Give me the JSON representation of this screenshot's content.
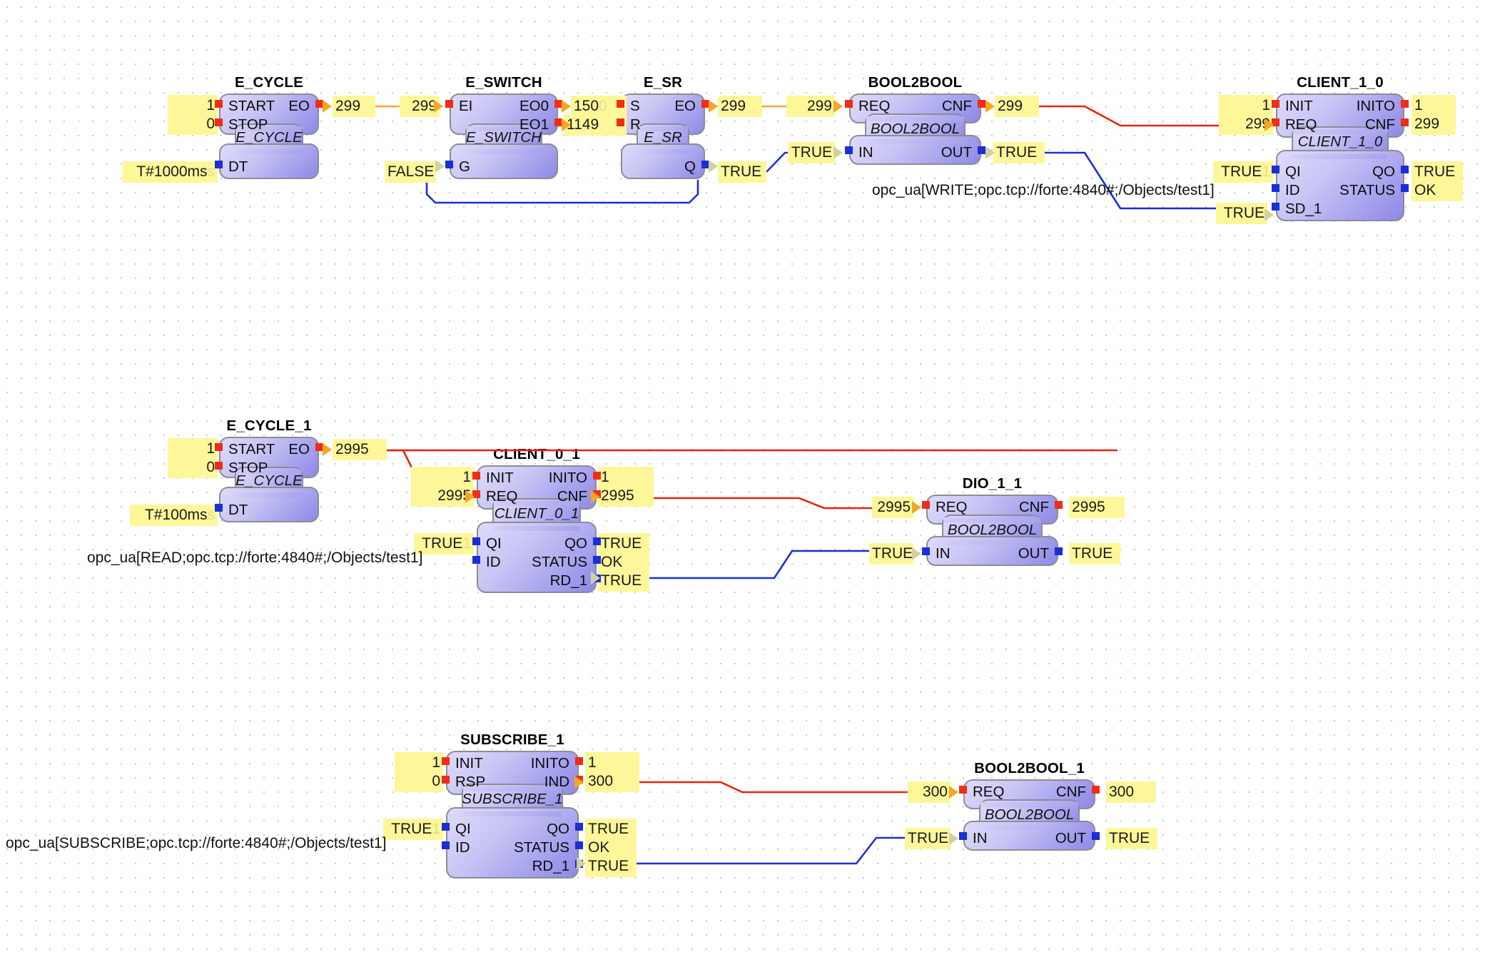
{
  "editor": {
    "kind": "iec61499-fb-network",
    "background": "#ffffff",
    "grid_dot_color": "#c9c9c9",
    "colors": {
      "event_pin": "#ef2d18",
      "data_pin": "#1a2fd6",
      "event_wire": "#e8240f",
      "data_wire": "#1a2fd6",
      "watch_value_bg": "#fdf79a",
      "fb_fill_light": "#dedcfa",
      "fb_fill_dark": "#8e89e6",
      "fb_border": "#8c8c96"
    }
  },
  "blocks": [
    {
      "id": "e_cycle",
      "instance_name": "E_CYCLE",
      "type_name": "E_CYCLE",
      "event_inputs": [
        {
          "name": "START",
          "value": "1"
        },
        {
          "name": "STOP",
          "value": "0"
        }
      ],
      "event_outputs": [
        {
          "name": "EO",
          "value": "299"
        }
      ],
      "data_inputs": [
        {
          "name": "DT",
          "value": "T#1000ms",
          "ghost": "s"
        }
      ],
      "data_outputs": []
    },
    {
      "id": "e_switch",
      "instance_name": "E_SWITCH",
      "type_name": "E_SWITCH",
      "event_inputs": [
        {
          "name": "EI",
          "value": "299"
        }
      ],
      "event_outputs": [
        {
          "name": "EO0",
          "value": "150",
          "ghost": "0"
        },
        {
          "name": "EO1",
          "value": "1149",
          "ghost": "114"
        }
      ],
      "data_inputs": [
        {
          "name": "G",
          "value": "FALSE"
        }
      ],
      "data_outputs": []
    },
    {
      "id": "e_sr",
      "instance_name": "E_SR",
      "type_name": "E_SR",
      "event_inputs": [
        {
          "name": "S",
          "value": ""
        },
        {
          "name": "R",
          "value": ""
        }
      ],
      "event_outputs": [
        {
          "name": "EO",
          "value": "299"
        }
      ],
      "data_inputs": [],
      "data_outputs": [
        {
          "name": "Q",
          "value": "TRUE"
        }
      ]
    },
    {
      "id": "bool2bool",
      "instance_name": "BOOL2BOOL",
      "type_name": "BOOL2BOOL",
      "event_inputs": [
        {
          "name": "REQ",
          "value": "299"
        }
      ],
      "event_outputs": [
        {
          "name": "CNF",
          "value": "299"
        }
      ],
      "data_inputs": [
        {
          "name": "IN",
          "value": "TRUE"
        }
      ],
      "data_outputs": [
        {
          "name": "OUT",
          "value": "TRUE"
        }
      ]
    },
    {
      "id": "client_1_0",
      "instance_name": "CLIENT_1_0",
      "type_name": "CLIENT_1_0",
      "event_inputs": [
        {
          "name": "INIT",
          "value": "1"
        },
        {
          "name": "REQ",
          "value": "299"
        }
      ],
      "event_outputs": [
        {
          "name": "INITO",
          "value": "1"
        },
        {
          "name": "CNF",
          "value": "299"
        }
      ],
      "data_inputs": [
        {
          "name": "QI",
          "value": "TRUE",
          "ghost": "1"
        },
        {
          "name": "ID",
          "value": "opc_ua[WRITE;opc.tcp://forte:4840#;/Objects/test1]"
        },
        {
          "name": "SD_1",
          "value": "TRUE"
        }
      ],
      "data_outputs": [
        {
          "name": "QO",
          "value": "TRUE"
        },
        {
          "name": "STATUS",
          "value": "OK"
        }
      ]
    },
    {
      "id": "e_cycle_1",
      "instance_name": "E_CYCLE_1",
      "type_name": "E_CYCLE",
      "event_inputs": [
        {
          "name": "START",
          "value": "1"
        },
        {
          "name": "STOP",
          "value": "0"
        }
      ],
      "event_outputs": [
        {
          "name": "EO",
          "value": "2995"
        }
      ],
      "data_inputs": [
        {
          "name": "DT",
          "value": "T#100ms",
          "ghost": "s"
        }
      ],
      "data_outputs": []
    },
    {
      "id": "client_0_1",
      "instance_name": "CLIENT_0_1",
      "type_name": "CLIENT_0_1",
      "event_inputs": [
        {
          "name": "INIT",
          "value": "1"
        },
        {
          "name": "REQ",
          "value": "2995"
        }
      ],
      "event_outputs": [
        {
          "name": "INITO",
          "value": "1"
        },
        {
          "name": "CNF",
          "value": "2995"
        }
      ],
      "data_inputs": [
        {
          "name": "QI",
          "value": "TRUE",
          "ghost": "1"
        },
        {
          "name": "ID",
          "value": "opc_ua[READ;opc.tcp://forte:4840#;/Objects/test1]"
        }
      ],
      "data_outputs": [
        {
          "name": "QO",
          "value": "TRUE"
        },
        {
          "name": "STATUS",
          "value": "OK"
        },
        {
          "name": "RD_1",
          "value": "TRUE"
        }
      ]
    },
    {
      "id": "dio_1_1",
      "instance_name": "DIO_1_1",
      "type_name": "BOOL2BOOL",
      "event_inputs": [
        {
          "name": "REQ",
          "value": "2995"
        }
      ],
      "event_outputs": [
        {
          "name": "CNF",
          "value": "2995"
        }
      ],
      "data_inputs": [
        {
          "name": "IN",
          "value": "TRUE"
        }
      ],
      "data_outputs": [
        {
          "name": "OUT",
          "value": "TRUE"
        }
      ]
    },
    {
      "id": "subscribe_1",
      "instance_name": "SUBSCRIBE_1",
      "type_name": "SUBSCRIBE_1",
      "event_inputs": [
        {
          "name": "INIT",
          "value": "1"
        },
        {
          "name": "RSP",
          "value": "0"
        }
      ],
      "event_outputs": [
        {
          "name": "INITO",
          "value": "1"
        },
        {
          "name": "IND",
          "value": "300"
        }
      ],
      "data_inputs": [
        {
          "name": "QI",
          "value": "TRUE",
          "ghost": "1"
        },
        {
          "name": "ID",
          "value": "opc_ua[SUBSCRIBE;opc.tcp://forte:4840#;/Objects/test1]"
        }
      ],
      "data_outputs": [
        {
          "name": "QO",
          "value": "TRUE"
        },
        {
          "name": "STATUS",
          "value": "OK"
        },
        {
          "name": "RD_1",
          "value": "TRUE"
        }
      ]
    },
    {
      "id": "bool2bool_1",
      "instance_name": "BOOL2BOOL_1",
      "type_name": "BOOL2BOOL",
      "event_inputs": [
        {
          "name": "REQ",
          "value": "300"
        }
      ],
      "event_outputs": [
        {
          "name": "CNF",
          "value": "300"
        }
      ],
      "data_inputs": [
        {
          "name": "IN",
          "value": "TRUE"
        }
      ],
      "data_outputs": [
        {
          "name": "OUT",
          "value": "TRUE"
        }
      ]
    }
  ],
  "labels": {
    "e_cycle_title": "E_CYCLE",
    "e_cycle_type": "E_CYCLE",
    "e_cycle_start": "START",
    "e_cycle_stop": "STOP",
    "e_cycle_dt": "DT",
    "e_cycle_eo": "EO",
    "e_cycle_start_val": "1",
    "e_cycle_stop_val": "0",
    "e_cycle_dt_val": "T#1000ms",
    "e_cycle_dt_ghost": "s",
    "e_cycle_eo_val": "299",
    "e_cycle_eo_val2": "299",
    "e_switch_title": "E_SWITCH",
    "e_switch_type": "E_SWITCH",
    "e_switch_ei": "EI",
    "e_switch_g": "G",
    "e_switch_eo0": "EO0",
    "e_switch_eo1": "EO1",
    "e_switch_g_val": "FALSE",
    "e_switch_eo0_val": "150",
    "e_switch_eo0_ghost": "0",
    "e_switch_eo1_val": "1149",
    "e_sr_title": "E_SR",
    "e_sr_type": "E_SR",
    "e_sr_s": "S",
    "e_sr_r": "R",
    "e_sr_eo": "EO",
    "e_sr_q": "Q",
    "e_sr_eo_val": "299",
    "e_sr_eo_val2": "299",
    "e_sr_q_val": "TRUE",
    "b2b_title": "BOOL2BOOL",
    "b2b_type": "BOOL2BOOL",
    "b2b_req": "REQ",
    "b2b_cnf": "CNF",
    "b2b_in": "IN",
    "b2b_out": "OUT",
    "b2b_req_val": "299",
    "b2b_cnf_val": "299",
    "b2b_in_val": "TRUE",
    "b2b_out_val": "TRUE",
    "b2b_id_annot": "opc_ua[WRITE;opc.tcp://forte:4840#;/Objects/test1]",
    "c10_title": "CLIENT_1_0",
    "c10_type": "CLIENT_1_0",
    "c10_init": "INIT",
    "c10_req": "REQ",
    "c10_inito": "INITO",
    "c10_cnf": "CNF",
    "c10_qi": "QI",
    "c10_id": "ID",
    "c10_sd1": "SD_1",
    "c10_qo": "QO",
    "c10_status": "STATUS",
    "c10_init_val": "1",
    "c10_req_val": "299",
    "c10_inito_val": "1",
    "c10_cnf_val": "299",
    "c10_qi_val": "TRUE",
    "c10_qi_ghost": "1",
    "c10_sd1_val": "TRUE",
    "c10_qo_val": "TRUE",
    "c10_status_val": "OK",
    "ec1_title": "E_CYCLE_1",
    "ec1_type": "E_CYCLE",
    "ec1_start": "START",
    "ec1_stop": "STOP",
    "ec1_dt": "DT",
    "ec1_eo": "EO",
    "ec1_start_val": "1",
    "ec1_stop_val": "0",
    "ec1_dt_val": "T#100ms",
    "ec1_dt_ghost": "s",
    "ec1_eo_val": "2995",
    "c01_title": "CLIENT_0_1",
    "c01_type": "CLIENT_0_1",
    "c01_init": "INIT",
    "c01_req": "REQ",
    "c01_inito": "INITO",
    "c01_cnf": "CNF",
    "c01_qi": "QI",
    "c01_id": "ID",
    "c01_qo": "QO",
    "c01_status": "STATUS",
    "c01_rd1": "RD_1",
    "c01_init_val": "1",
    "c01_req_val": "2995",
    "c01_inito_val": "1",
    "c01_cnf_val": "2995",
    "c01_qi_val": "TRUE",
    "c01_qi_ghost": "1",
    "c01_qo_val": "TRUE",
    "c01_status_val": "OK",
    "c01_rd1_val": "TRUE",
    "c01_id_annot": "opc_ua[READ;opc.tcp://forte:4840#;/Objects/test1]",
    "dio_title": "DIO_1_1",
    "dio_type": "BOOL2BOOL",
    "dio_req": "REQ",
    "dio_cnf": "CNF",
    "dio_in": "IN",
    "dio_out": "OUT",
    "dio_req_val": "2995",
    "dio_cnf_val": "2995",
    "dio_in_val": "TRUE",
    "dio_out_val": "TRUE",
    "sub_title": "SUBSCRIBE_1",
    "sub_type": "SUBSCRIBE_1",
    "sub_init": "INIT",
    "sub_rsp": "RSP",
    "sub_inito": "INITO",
    "sub_ind": "IND",
    "sub_qi": "QI",
    "sub_id": "ID",
    "sub_qo": "QO",
    "sub_status": "STATUS",
    "sub_rd1": "RD_1",
    "sub_init_val": "1",
    "sub_rsp_val": "0",
    "sub_inito_val": "1",
    "sub_ind_val": "300",
    "sub_qi_val": "TRUE",
    "sub_qi_ghost": "1",
    "sub_qo_val": "TRUE",
    "sub_status_val": "OK",
    "sub_rd1_val": "TRUE",
    "sub_id_annot": "opc_ua[SUBSCRIBE;opc.tcp://forte:4840#;/Objects/test1]",
    "b2b1_title": "BOOL2BOOL_1",
    "b2b1_type": "BOOL2BOOL",
    "b2b1_req": "REQ",
    "b2b1_cnf": "CNF",
    "b2b1_in": "IN",
    "b2b1_out": "OUT",
    "b2b1_req_val": "300",
    "b2b1_cnf_val": "300",
    "b2b1_in_val": "TRUE",
    "b2b1_out_val": "TRUE"
  }
}
